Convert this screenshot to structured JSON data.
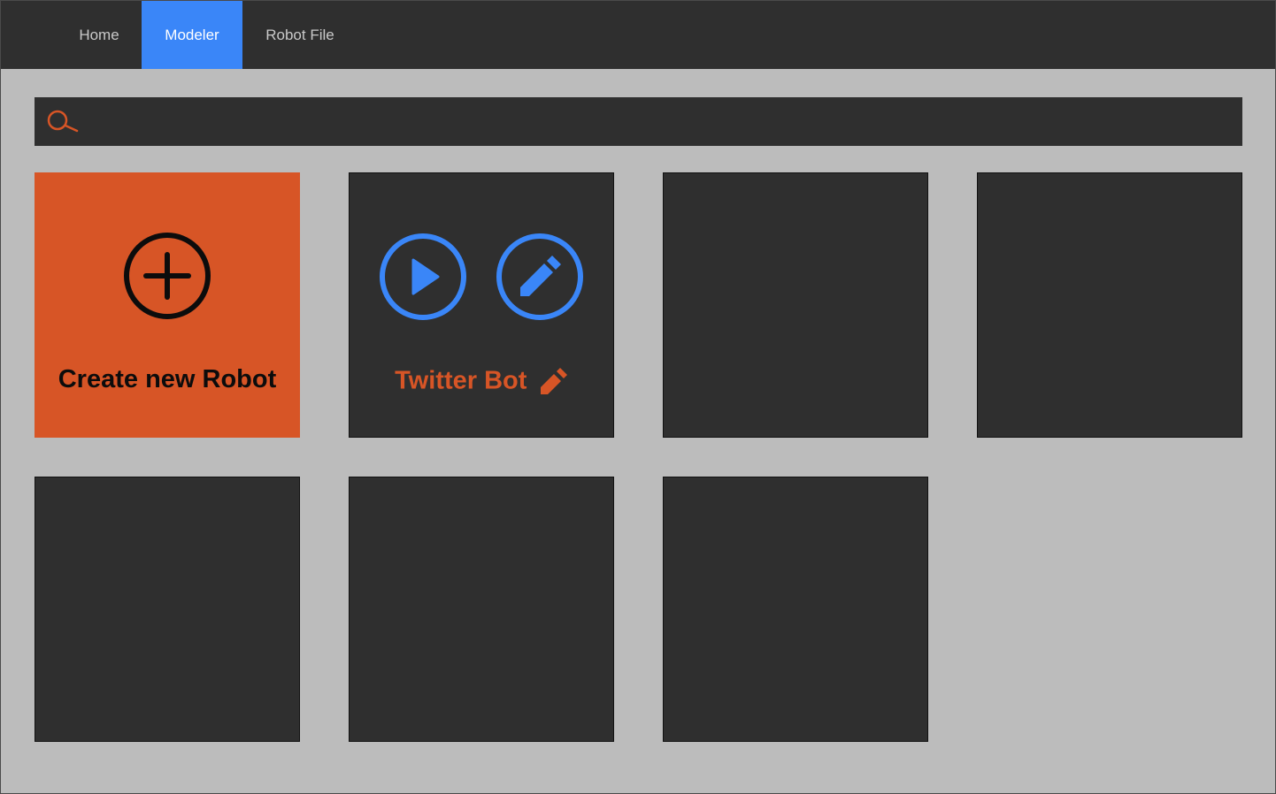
{
  "nav": {
    "items": [
      {
        "label": "Home",
        "active": false
      },
      {
        "label": "Modeler",
        "active": true
      },
      {
        "label": "Robot File",
        "active": false
      }
    ]
  },
  "search": {
    "icon": "search-icon",
    "value": "",
    "placeholder": ""
  },
  "tiles": {
    "create": {
      "icon": "plus-circle-icon",
      "label": "Create new Robot"
    },
    "robots": [
      {
        "name": "Twitter Bot",
        "run_icon": "play-icon",
        "edit_icon": "pencil-icon",
        "rename_icon": "pencil-icon"
      }
    ],
    "empty_slots": 5
  },
  "colors": {
    "background": "#bcbcbc",
    "panel": "#2f2f2f",
    "accent_blue": "#3a86f8",
    "accent_orange": "#d75526"
  }
}
